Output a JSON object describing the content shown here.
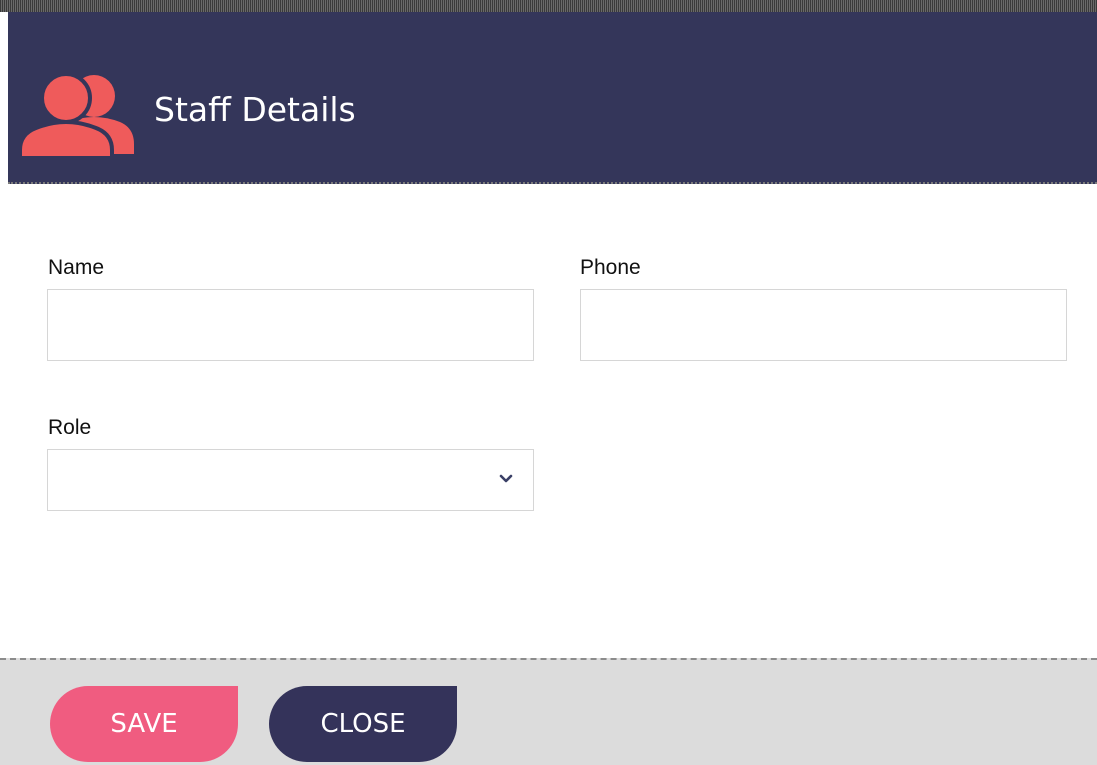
{
  "header": {
    "title": "Staff Details",
    "icon": "staff-group-icon",
    "background_color": "#34365a",
    "icon_color": "#ef5b5b"
  },
  "form": {
    "name": {
      "label": "Name",
      "value": "",
      "placeholder": ""
    },
    "phone": {
      "label": "Phone",
      "value": "",
      "placeholder": ""
    },
    "role": {
      "label": "Role",
      "selected": ""
    }
  },
  "footer": {
    "save_label": "SAVE",
    "close_label": "CLOSE",
    "save_color": "#f05c80",
    "close_color": "#34335a"
  }
}
